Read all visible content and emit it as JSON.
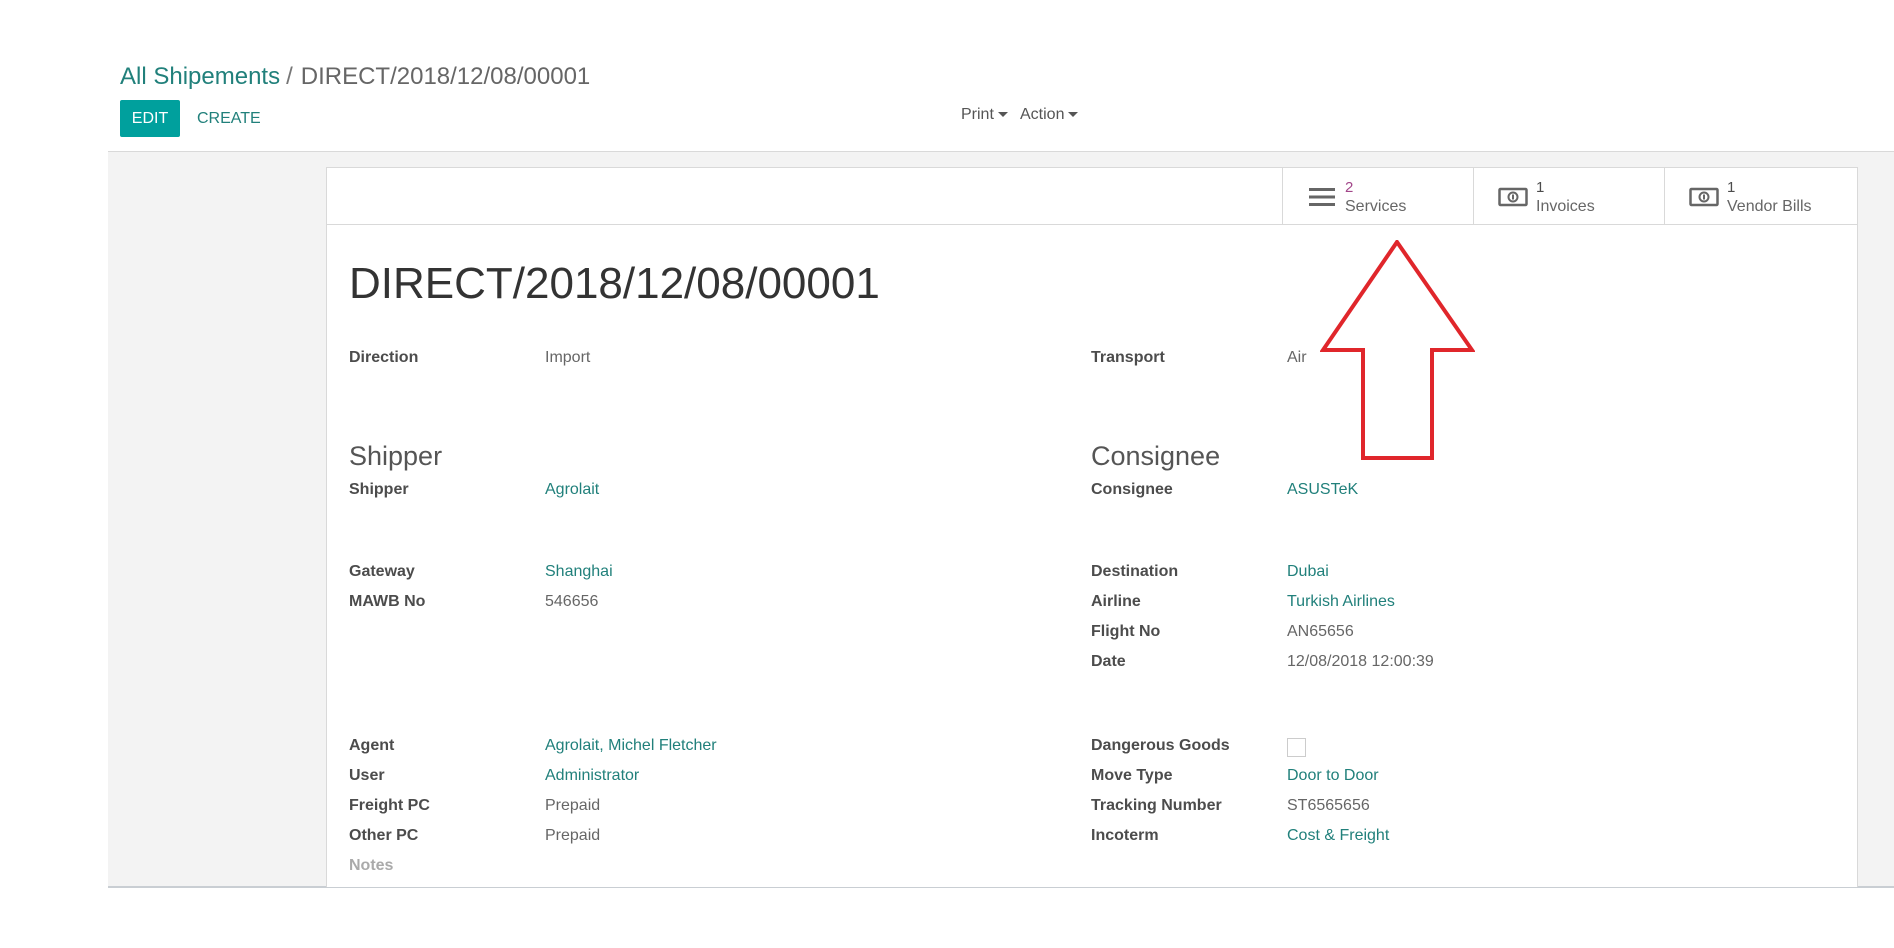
{
  "breadcrumb": {
    "parent": "All Shipements",
    "separator": "/",
    "current": "DIRECT/2018/12/08/00001"
  },
  "toolbar": {
    "edit_label": "EDIT",
    "create_label": "CREATE",
    "print_label": "Print",
    "action_label": "Action"
  },
  "smart_buttons": [
    {
      "count": "2",
      "label": "Services",
      "icon": "list-icon",
      "count_color": "#a24689"
    },
    {
      "count": "1",
      "label": "Invoices",
      "icon": "money-icon",
      "count_color": "#666666"
    },
    {
      "count": "1",
      "label": "Vendor Bills",
      "icon": "money-icon",
      "count_color": "#666666"
    }
  ],
  "record": {
    "title": "DIRECT/2018/12/08/00001",
    "direction_label": "Direction",
    "direction_value": "Import",
    "transport_label": "Transport",
    "transport_value": "Air",
    "shipper_section": "Shipper",
    "shipper_label": "Shipper",
    "shipper_value": "Agrolait",
    "consignee_section": "Consignee",
    "consignee_label": "Consignee",
    "consignee_value": "ASUSTeK",
    "gateway_label": "Gateway",
    "gateway_value": "Shanghai",
    "mawb_label": "MAWB No",
    "mawb_value": "546656",
    "destination_label": "Destination",
    "destination_value": "Dubai",
    "airline_label": "Airline",
    "airline_value": "Turkish Airlines",
    "flight_label": "Flight No",
    "flight_value": "AN65656",
    "date_label": "Date",
    "date_value": "12/08/2018 12:00:39",
    "agent_label": "Agent",
    "agent_value": "Agrolait, Michel Fletcher",
    "user_label": "User",
    "user_value": "Administrator",
    "freight_label": "Freight PC",
    "freight_value": "Prepaid",
    "other_label": "Other PC",
    "other_value": "Prepaid",
    "notes_label": "Notes",
    "dangerous_label": "Dangerous Goods",
    "dangerous_value": false,
    "move_label": "Move Type",
    "move_value": "Door to Door",
    "tracking_label": "Tracking Number",
    "tracking_value": "ST6565656",
    "incoterm_label": "Incoterm",
    "incoterm_value": "Cost & Freight"
  },
  "colors": {
    "accent": "#00a09d",
    "link": "#21807b",
    "annotation_arrow": "#e0262b"
  }
}
